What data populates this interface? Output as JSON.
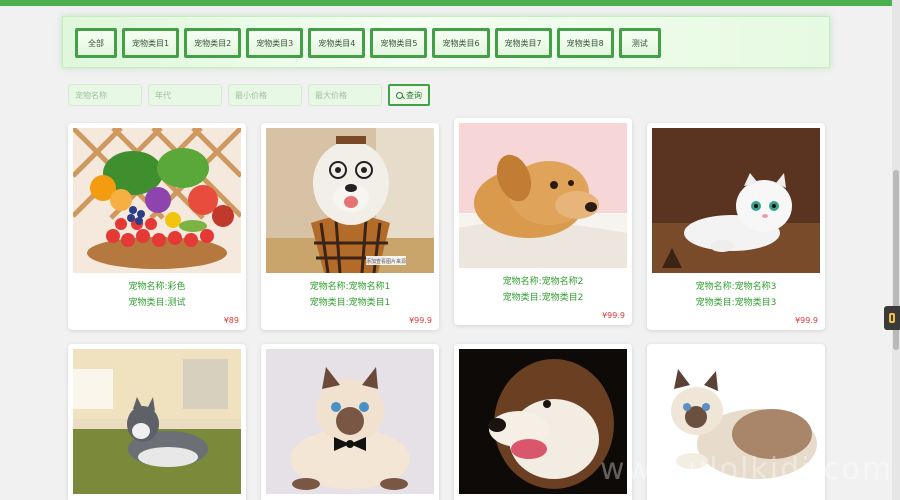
{
  "categories": [
    "全部",
    "宠物类目1",
    "宠物类目2",
    "宠物类目3",
    "宠物类目4",
    "宠物类目5",
    "宠物类目6",
    "宠物类目7",
    "宠物类目8",
    "测试"
  ],
  "search": {
    "name_placeholder": "宠物名称",
    "age_placeholder": "年代",
    "min_price_placeholder": "最小价格",
    "max_price_placeholder": "最大价格",
    "button_label": "查询"
  },
  "pets": [
    {
      "name": "宠物名称:彩色",
      "category": "宠物类目:测试",
      "price": "¥89",
      "image": "fruits-and-vegetables"
    },
    {
      "name": "宠物名称:宠物名称1",
      "category": "宠物类目:宠物类目1",
      "price": "¥99.9",
      "image": "dog-in-plaid-suit"
    },
    {
      "name": "宠物名称:宠物名称2",
      "category": "宠物类目:宠物类目2",
      "price": "¥99.9",
      "image": "golden-retriever-puppy"
    },
    {
      "name": "宠物名称:宠物名称3",
      "category": "宠物类目:宠物类目3",
      "price": "¥99.9",
      "image": "white-scottish-fold-cat"
    },
    {
      "name": "",
      "category": "",
      "price": "",
      "image": "husky-on-grass"
    },
    {
      "name": "",
      "category": "",
      "price": "",
      "image": "siamese-cat-bowtie"
    },
    {
      "name": "",
      "category": "",
      "price": "",
      "image": "alaskan-malamute"
    },
    {
      "name": "",
      "category": "",
      "price": "",
      "image": "ragdoll-cat"
    }
  ],
  "image_caption": "添加查看图片来源",
  "watermark": "www.ulolkidi.com",
  "colors": {
    "accent": "#43a047",
    "price": "#e53935",
    "text_green": "#2e9e2e"
  }
}
